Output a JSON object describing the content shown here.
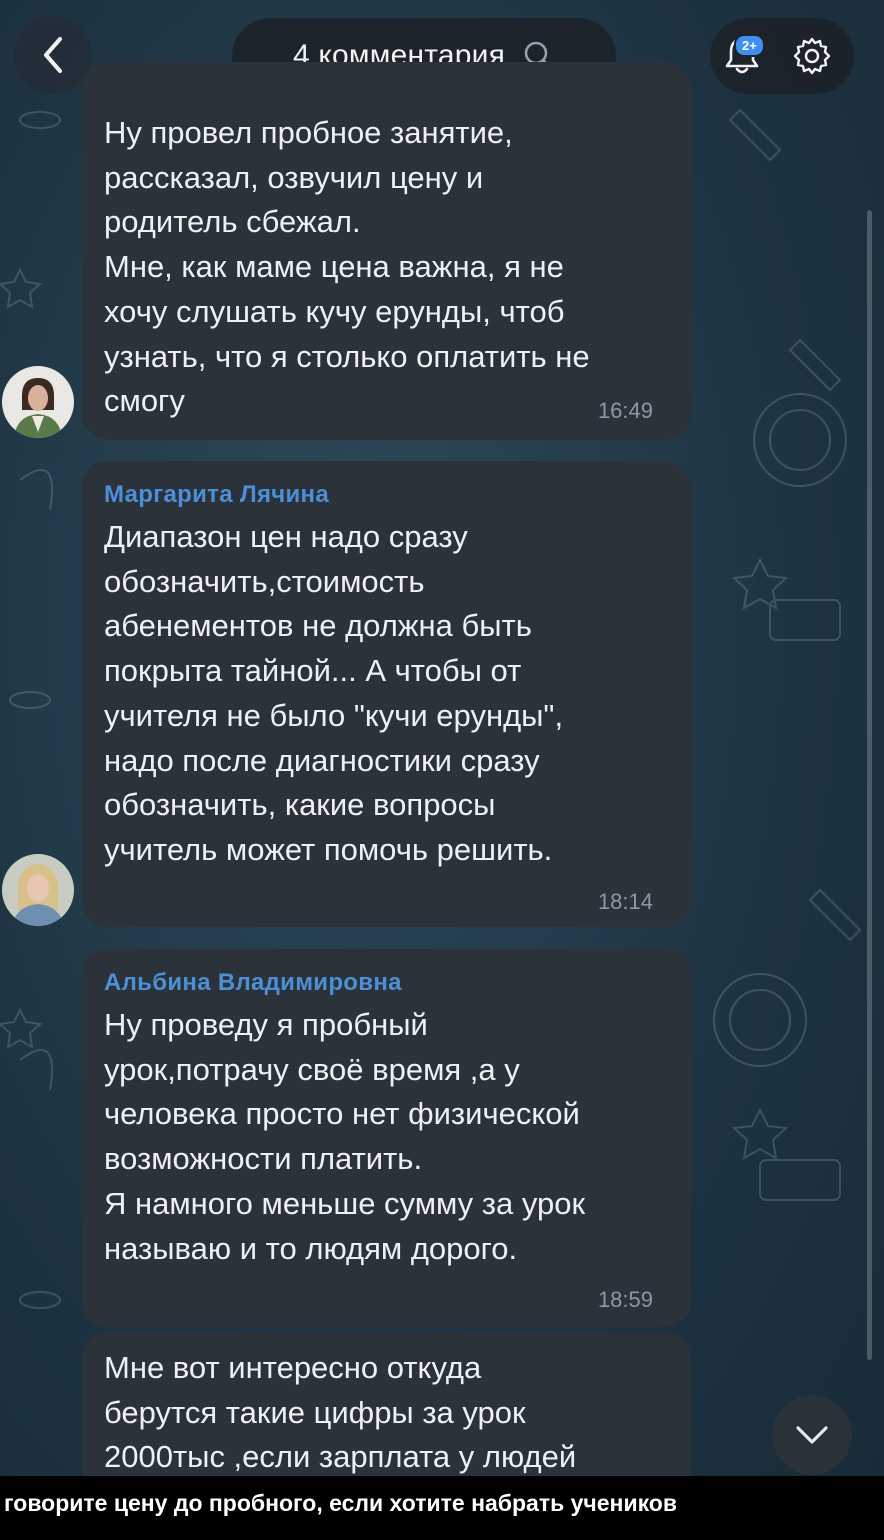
{
  "header": {
    "title": "4 комментария",
    "notification_badge": "2+"
  },
  "messages": [
    {
      "author": "",
      "text": "Ну провел пробное занятие,\nрассказал, озвучил цену и\nродитель сбежал.\nМне, как маме цена важна, я не\nхочу слушать кучу ерунды, чтоб\nузнать, что я столько оплатить не\nсмогу",
      "time": "16:49"
    },
    {
      "author": "Маргарита Лячина",
      "text": "Диапазон цен надо сразу\nобозначить,стоимость\nабенементов не должна быть\nпокрыта тайной... А чтобы от\nучителя не было \"кучи ерунды\",\nнадо после диагностики сразу\nобозначить, какие вопросы\nучитель может помочь решить.",
      "time": "18:14"
    },
    {
      "author": "Альбина Владимировна",
      "text": "Ну проведу я пробный\nурок,потрачу своё время ,а у\nчеловека просто нет физической\nвозможности платить.\nЯ намного меньше сумму за урок\nназываю и то людям дорого.",
      "time": "18:59"
    },
    {
      "author": "",
      "text": "Мне вот интересно откуда\nберутся такие цифры за урок\n2000тыс ,если зарплата у людей",
      "time": ""
    }
  ],
  "caption": {
    "text": "говорите цену до пробного, если хотите набрать учеников"
  },
  "colors": {
    "accent": "#4b8fd6",
    "bubble": "#2b323a",
    "badge": "#3d8ff0"
  },
  "icons": [
    "back-arrow-icon",
    "search-icon",
    "bell-icon",
    "gear-icon",
    "chevron-down-icon"
  ]
}
